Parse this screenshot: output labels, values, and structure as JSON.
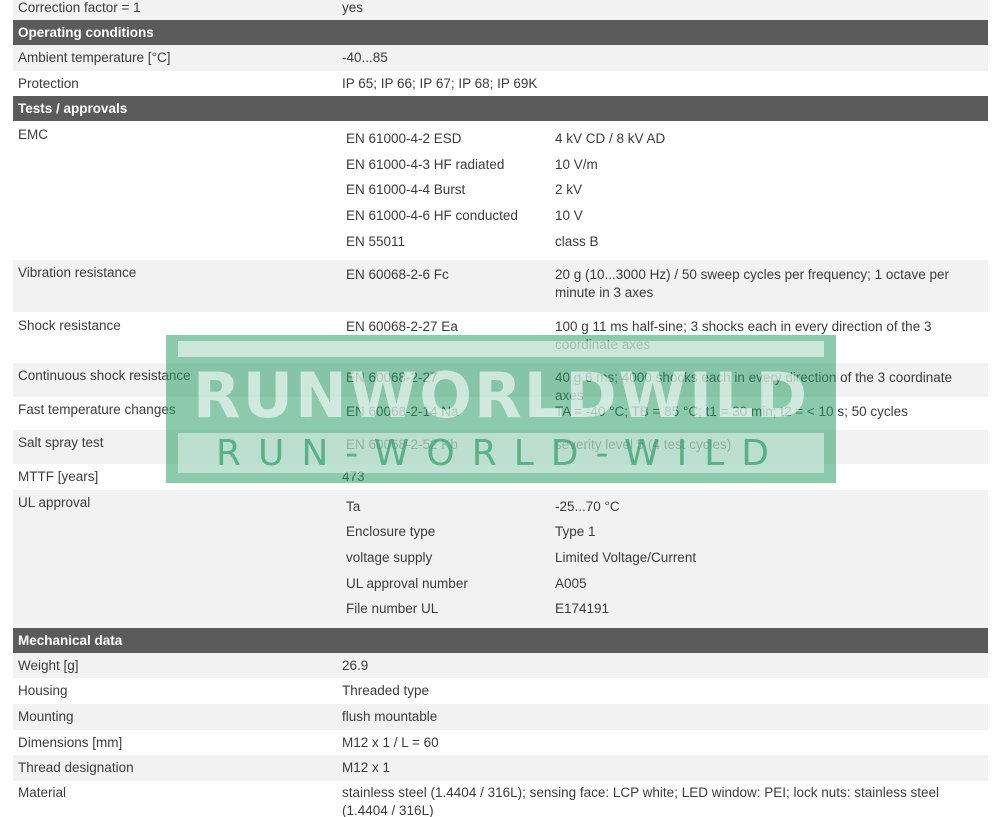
{
  "top_row": {
    "label": "Correction factor = 1",
    "value": "yes"
  },
  "operating": {
    "header": "Operating conditions",
    "ambient": {
      "label": "Ambient temperature [°C]",
      "value": "-40...85"
    },
    "protection": {
      "label": "Protection",
      "value": "IP 65; IP 66; IP 67; IP 68; IP 69K"
    }
  },
  "tests": {
    "header": "Tests / approvals",
    "emc": {
      "label": "EMC",
      "items": [
        {
          "standard": "EN 61000-4-2 ESD",
          "value": "4 kV CD / 8 kV AD"
        },
        {
          "standard": "EN 61000-4-3 HF radiated",
          "value": "10 V/m"
        },
        {
          "standard": "EN 61000-4-4 Burst",
          "value": "2 kV"
        },
        {
          "standard": "EN 61000-4-6 HF conducted",
          "value": "10 V"
        },
        {
          "standard": "EN 55011",
          "value": "class B"
        }
      ]
    },
    "vibration": {
      "label": "Vibration resistance",
      "standard": "EN 60068-2-6 Fc",
      "value": "20 g (10...3000 Hz) / 50 sweep cycles per frequency; 1 octave per minute in 3 axes"
    },
    "shock": {
      "label": "Shock resistance",
      "standard": "EN 60068-2-27 Ea",
      "value": "100 g 11 ms half-sine; 3 shocks each in every direction of the 3 coordinate axes"
    },
    "cont_shock": {
      "label": "Continuous shock resistance",
      "standard": "EN 60068-2-27",
      "value": "40 g 6 ms; 4000 shocks each in every direction of the 3 coordinate axes"
    },
    "temp_change": {
      "label": "Fast temperature changes",
      "standard": "EN 60068-2-14 Na",
      "value": "TA = -40 °C; TB = 85 °C; t1 = 30 min; t2 = < 10 s; 50 cycles"
    },
    "salt_spray": {
      "label": "Salt spray test",
      "standard": "EN 60068-2-52 Kb",
      "value": "severity level 5 (4 test cycles)"
    },
    "mttf": {
      "label": "MTTF [years]",
      "value": "473"
    },
    "ul": {
      "label": "UL approval",
      "items": [
        {
          "key": "Ta",
          "value": "-25...70 °C"
        },
        {
          "key": "Enclosure type",
          "value": "Type 1"
        },
        {
          "key": "voltage supply",
          "value": "Limited Voltage/Current"
        },
        {
          "key": "UL approval number",
          "value": "A005"
        },
        {
          "key": "File number UL",
          "value": "E174191"
        }
      ]
    }
  },
  "mechanical": {
    "header": "Mechanical data",
    "weight": {
      "label": "Weight [g]",
      "value": "26.9"
    },
    "housing": {
      "label": "Housing",
      "value": "Threaded type"
    },
    "mounting": {
      "label": "Mounting",
      "value": "flush mountable"
    },
    "dimensions": {
      "label": "Dimensions [mm]",
      "value": "M12 x 1 / L = 60"
    },
    "thread": {
      "label": "Thread designation",
      "value": "M12 x 1"
    },
    "material": {
      "label": "Material",
      "value": "stainless steel (1.4404 / 316L); sensing face: LCP white; LED window: PEI; lock nuts: stainless steel (1.4404 / 316L)"
    }
  },
  "watermark": {
    "line1": "RUNWORLDWILD",
    "line2": "RUN-WORLD-WILD",
    "color": "#2e9e6a"
  }
}
